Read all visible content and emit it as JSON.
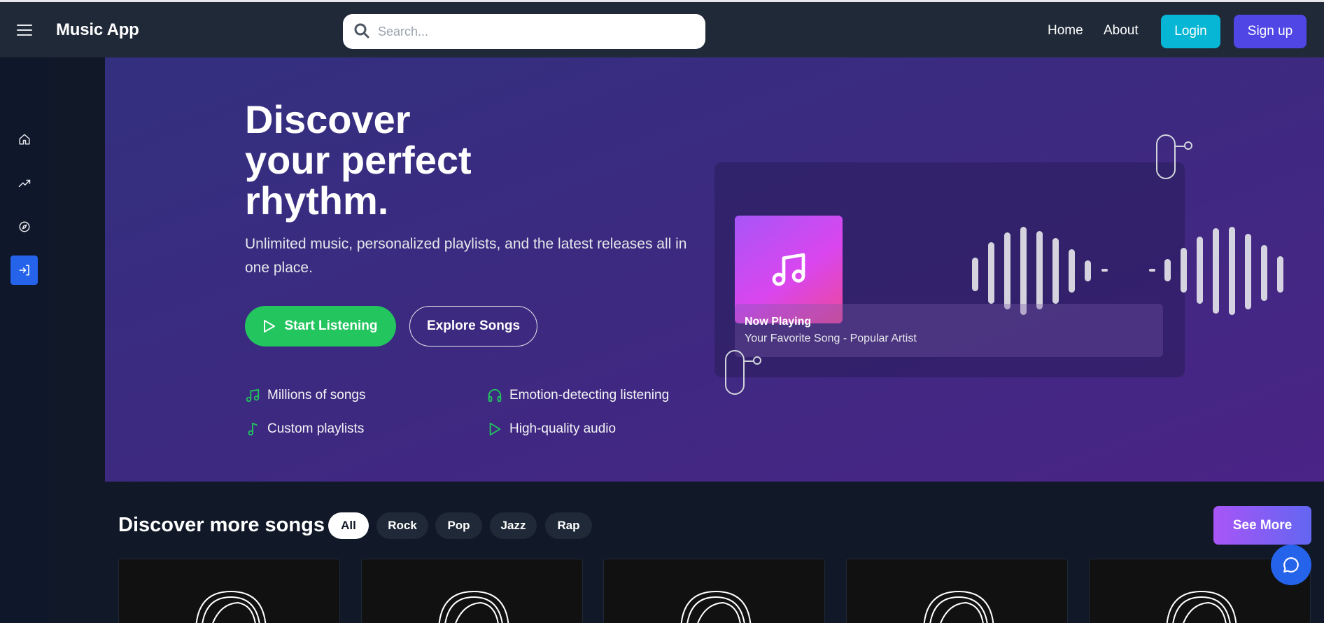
{
  "header": {
    "app_title": "Music App",
    "search_placeholder": "Search...",
    "nav": [
      {
        "label": "Home"
      },
      {
        "label": "About"
      }
    ],
    "login_label": "Login",
    "signup_label": "Sign up"
  },
  "sidebar": {
    "items": [
      {
        "icon": "home-icon"
      },
      {
        "icon": "trending-icon"
      },
      {
        "icon": "compass-icon"
      },
      {
        "icon": "login-icon",
        "active": true
      }
    ]
  },
  "hero": {
    "title_lines": [
      "Discover",
      "your perfect",
      "rhythm."
    ],
    "subtitle": "Unlimited music, personalized playlists, and the latest releases all in one place.",
    "start_label": "Start Listening",
    "explore_label": "Explore Songs",
    "features": [
      {
        "label": "Millions of songs",
        "icon": "music-notes-icon"
      },
      {
        "label": "Emotion-detecting listening",
        "icon": "headphones-icon"
      },
      {
        "label": "Custom playlists",
        "icon": "music-note-icon"
      },
      {
        "label": "High-quality audio",
        "icon": "play-icon"
      }
    ]
  },
  "player": {
    "now_playing_label": "Now Playing",
    "song_line": "Your Favorite Song - Popular Artist"
  },
  "discover": {
    "title": "Discover more songs",
    "filters": [
      {
        "label": "All",
        "active": true
      },
      {
        "label": "Rock"
      },
      {
        "label": "Pop"
      },
      {
        "label": "Jazz"
      },
      {
        "label": "Rap"
      }
    ],
    "see_more_label": "See More"
  },
  "colors": {
    "accent_green": "#22c55e",
    "login_cyan": "#06b6d4",
    "signup_indigo": "#4f46e5",
    "active_blue": "#2563eb",
    "hero_purple": "#3c2a80"
  }
}
